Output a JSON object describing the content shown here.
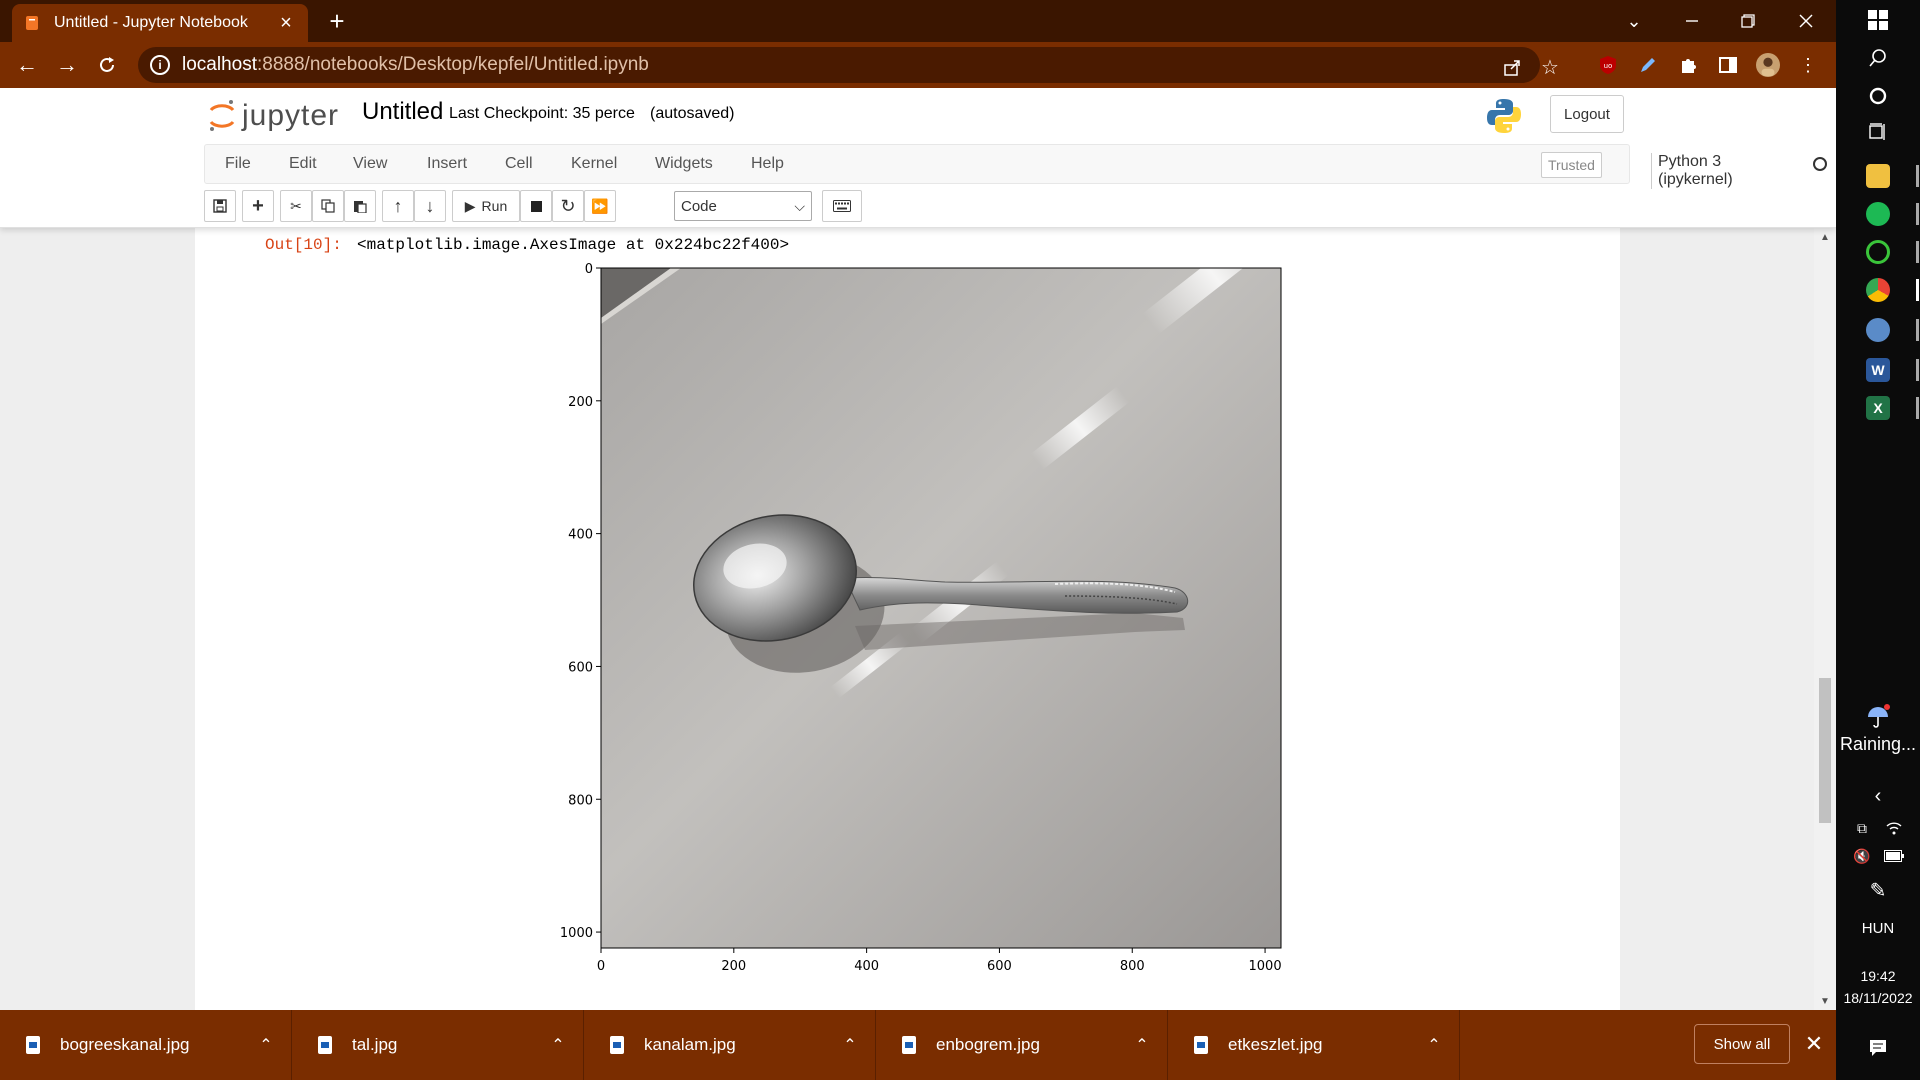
{
  "browser": {
    "tab_title": "Untitled - Jupyter Notebook",
    "url_host": "localhost",
    "url_path": ":8888/notebooks/Desktop/kepfel/Untitled.ipynb"
  },
  "notebook": {
    "logo_text": "jupyter",
    "name": "Untitled",
    "checkpoint": "Last Checkpoint: 35 perce",
    "autosave": "(autosaved)",
    "logout_label": "Logout",
    "menu": [
      "File",
      "Edit",
      "View",
      "Insert",
      "Cell",
      "Kernel",
      "Widgets",
      "Help"
    ],
    "trusted_label": "Trusted",
    "kernel_label": "Python 3 (ipykernel)",
    "toolbar": {
      "run_label": "Run",
      "cell_type": "Code"
    }
  },
  "output": {
    "prompt": "Out[10]:",
    "text": "<matplotlib.image.AxesImage at 0x224bc22f400>"
  },
  "chart_data": {
    "type": "image",
    "description_visible": "photo of a spoon on a table",
    "x_ticks": [
      "0",
      "200",
      "400",
      "600",
      "800",
      "1000"
    ],
    "y_ticks": [
      "0",
      "200",
      "400",
      "600",
      "800",
      "1000"
    ],
    "xlim": [
      0,
      1024
    ],
    "ylim": [
      1024,
      0
    ]
  },
  "downloads": {
    "items": [
      "bogreeskanal.jpg",
      "tal.jpg",
      "kanalam.jpg",
      "enbogrem.jpg",
      "etkeszlet.jpg"
    ],
    "show_all_label": "Show all"
  },
  "taskbar": {
    "weather": "Raining...",
    "language": "HUN",
    "time": "19:42",
    "date": "18/11/2022"
  }
}
